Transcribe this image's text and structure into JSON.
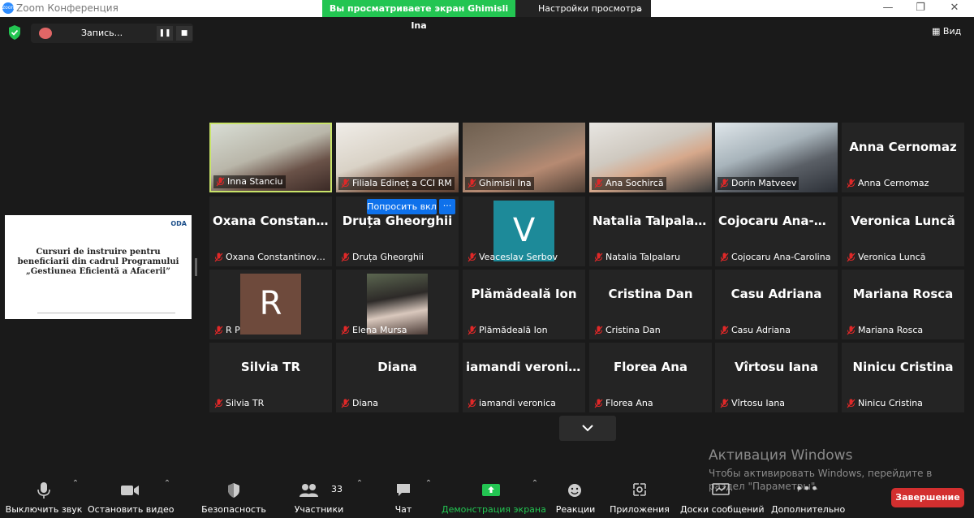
{
  "window": {
    "app_title": "Zoom Конференция"
  },
  "share": {
    "banner": "Вы просматриваете экран Ghimisli Ina",
    "view_settings": "Настройки просмотра"
  },
  "recording": {
    "label": "Запись..."
  },
  "view_button": "Вид",
  "slide": {
    "logo": "ODA",
    "title": "Cursuri de instruire pentru beneficiarii din cadrul Programului „Gestiunea Eficientă a Afacerii”"
  },
  "participants": [
    {
      "label": "Inna Stanciu",
      "video": true
    },
    {
      "label": "Filiala Edineț a CCI RM",
      "video": true
    },
    {
      "label": "Ghimisli Ina",
      "video": true
    },
    {
      "label": "Ana Sochircă",
      "video": true
    },
    {
      "label": "Dorin Matveev",
      "video": true
    },
    {
      "name": "Anna Cernomaz",
      "label": "Anna Cernomaz"
    },
    {
      "name": "Oxana  Constant...",
      "label": "Oxana Constantinova, ..."
    },
    {
      "name": "Druța Gheorghii",
      "label": "Druța Gheorghii"
    },
    {
      "avatar": "V",
      "label": "Veaceslav Serbov"
    },
    {
      "name": "Natalia Talpalaru",
      "label": "Natalia Talpalaru"
    },
    {
      "name": "Cojocaru  Ana-C...",
      "label": "Cojocaru Ana-Carolina"
    },
    {
      "name": "Veronica Luncă",
      "label": "Veronica Luncă"
    },
    {
      "avatar": "R",
      "label": "R P"
    },
    {
      "photo": true,
      "label": "Elena Mursa"
    },
    {
      "name": "Plămădeală Ion",
      "label": "Plămădeală Ion"
    },
    {
      "name": "Cristina Dan",
      "label": "Cristina Dan"
    },
    {
      "name": "Casu Adriana",
      "label": "Casu Adriana"
    },
    {
      "name": "Mariana Rosca",
      "label": "Mariana Rosca"
    },
    {
      "name": "Silvia TR",
      "label": "Silvia TR"
    },
    {
      "name": "Diana",
      "label": "Diana"
    },
    {
      "name": "iamandi veronica",
      "label": "iamandi veronica"
    },
    {
      "name": "Florea Ana",
      "label": "Florea Ana"
    },
    {
      "name": "Vîrtosu Iana",
      "label": "Vîrtosu Iana"
    },
    {
      "name": "Ninicu Cristina",
      "label": "Ninicu Cristina"
    }
  ],
  "ask_unmute": "Попросить вкл",
  "more_glyph": "···",
  "windows_activation": {
    "title": "Активация Windows",
    "text": "Чтобы активировать Windows, перейдите в раздел \"Параметры\"."
  },
  "toolbar": {
    "mute": "Выключить звук",
    "video": "Остановить видео",
    "security": "Безопасность",
    "participants": "Участники",
    "participants_count": "33",
    "chat": "Чат",
    "share": "Демонстрация экрана",
    "reactions": "Реакции",
    "apps": "Приложения",
    "whiteboards": "Доски сообщений",
    "more": "Дополнительно",
    "end": "Завершение"
  },
  "colors": {
    "share_green": "#23c552",
    "active_speaker": "#c9e46a",
    "mute_red": "#e02828",
    "avatar_v": "#1d8a99",
    "avatar_r": "#6e4a3c",
    "end_red": "#d32f2f",
    "primary_blue": "#0e71eb"
  }
}
